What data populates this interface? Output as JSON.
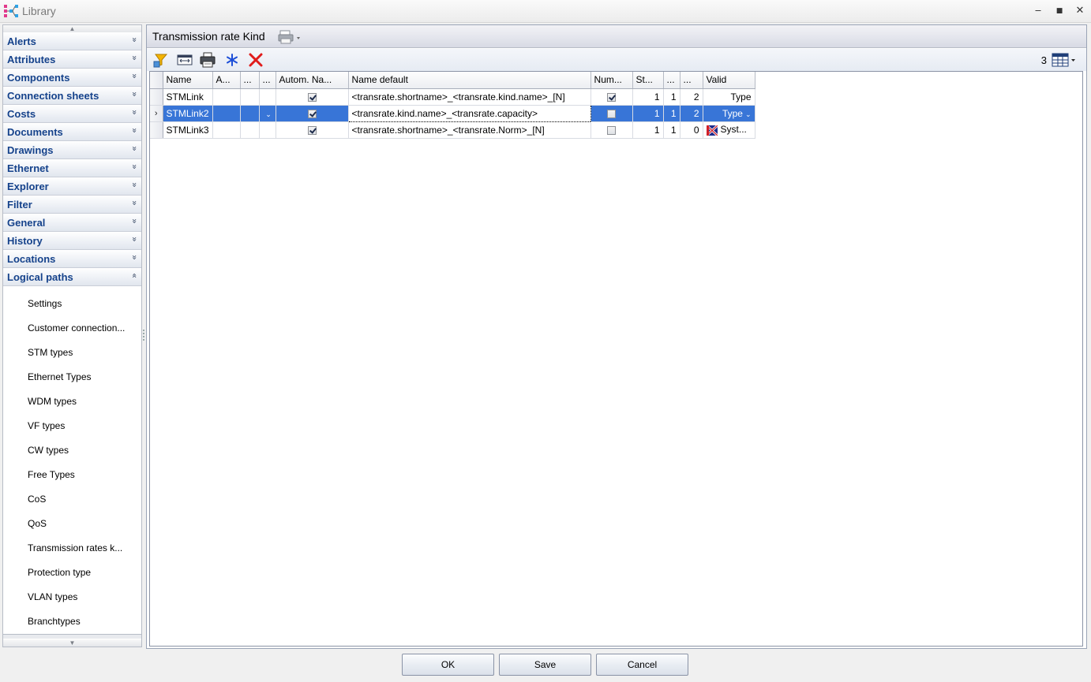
{
  "window": {
    "title": "Library",
    "minimize_glyph": "‒",
    "maximize_glyph": "■",
    "close_glyph": "✕"
  },
  "nav": {
    "groups": [
      {
        "label": "Alerts",
        "expanded": false
      },
      {
        "label": "Attributes",
        "expanded": false
      },
      {
        "label": "Components",
        "expanded": false
      },
      {
        "label": "Connection sheets",
        "expanded": false
      },
      {
        "label": "Costs",
        "expanded": false
      },
      {
        "label": "Documents",
        "expanded": false
      },
      {
        "label": "Drawings",
        "expanded": false
      },
      {
        "label": "Ethernet",
        "expanded": false
      },
      {
        "label": "Explorer",
        "expanded": false
      },
      {
        "label": "Filter",
        "expanded": false
      },
      {
        "label": "General",
        "expanded": false
      },
      {
        "label": "History",
        "expanded": false
      },
      {
        "label": "Locations",
        "expanded": false
      },
      {
        "label": "Logical paths",
        "expanded": true
      }
    ],
    "items": [
      "Settings",
      "Customer connection...",
      "STM types",
      "Ethernet Types",
      "WDM types",
      "VF types",
      "CW types",
      "Free Types",
      "CoS",
      "QoS",
      "Transmission rates k...",
      "Protection type",
      "VLAN types",
      "Branchtypes"
    ],
    "chevron_collapsed": "»",
    "chevron_expanded": "«"
  },
  "panel": {
    "title": "Transmission rate Kind",
    "record_count": "3"
  },
  "toolbar": {
    "icons": [
      "filter-icon",
      "column-width-icon",
      "print-icon",
      "freeze-icon",
      "delete-icon"
    ]
  },
  "grid": {
    "columns": [
      "Name",
      "A...",
      "...",
      "...",
      "Autom. Na...",
      "Name default",
      "Num...",
      "St...",
      "...",
      "...",
      "Valid"
    ],
    "rows": [
      {
        "name": "STMLink",
        "autom": true,
        "name_default": "<transrate.shortname>_<transrate.kind.name>_[N]",
        "num": true,
        "st": "1",
        "c9": "1",
        "c10": "2",
        "valid": "Type",
        "valid_icon": false,
        "selected": false
      },
      {
        "name": "STMLink2",
        "autom": true,
        "name_default": "<transrate.kind.name>_<transrate.capacity>",
        "num": false,
        "st": "1",
        "c9": "1",
        "c10": "2",
        "valid": "Type",
        "valid_icon": false,
        "selected": true
      },
      {
        "name": "STMLink3",
        "autom": true,
        "name_default": "<transrate.shortname>_<transrate.Norm>_[N]",
        "num": false,
        "st": "1",
        "c9": "1",
        "c10": "0",
        "valid": "Syst...",
        "valid_icon": true,
        "selected": false
      }
    ],
    "current_row_marker": "›"
  },
  "footer": {
    "ok_label": "OK",
    "save_label": "Save",
    "cancel_label": "Cancel"
  },
  "colors": {
    "nav_text": "#15428b",
    "selection": "#3875d7"
  }
}
